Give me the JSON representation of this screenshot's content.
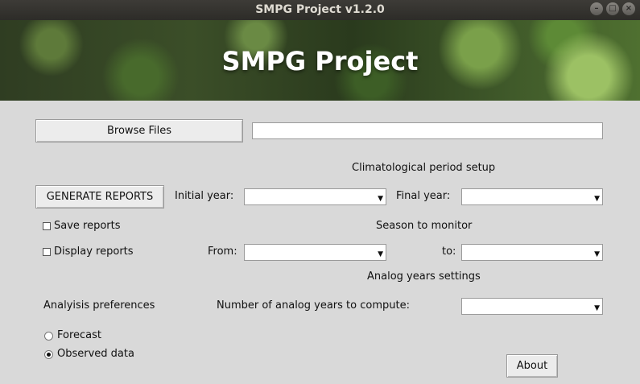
{
  "window": {
    "title": "SMPG Project v1.2.0",
    "controls": [
      "minimize-icon",
      "maximize-icon",
      "close-icon"
    ]
  },
  "banner": {
    "title": "SMPG Project"
  },
  "files": {
    "browse_label": "Browse Files",
    "path_value": ""
  },
  "climatology": {
    "heading": "Climatological period setup",
    "initial_label": "Initial year:",
    "initial_value": "",
    "final_label": "Final year:",
    "final_value": ""
  },
  "reports": {
    "generate_label": "GENERATE REPORTS",
    "save_label": "Save reports",
    "save_checked": false,
    "display_label": "Display reports",
    "display_checked": false
  },
  "season": {
    "heading": "Season to monitor",
    "from_label": "From:",
    "from_value": "",
    "to_label": "to:",
    "to_value": ""
  },
  "analog": {
    "heading": "Analog years settings",
    "count_label": "Number of analog years to compute:",
    "count_value": ""
  },
  "analysis": {
    "heading": "Analyisis preferences",
    "options": [
      {
        "label": "Forecast",
        "selected": false
      },
      {
        "label": "Observed data",
        "selected": true
      }
    ]
  },
  "about_label": "About"
}
